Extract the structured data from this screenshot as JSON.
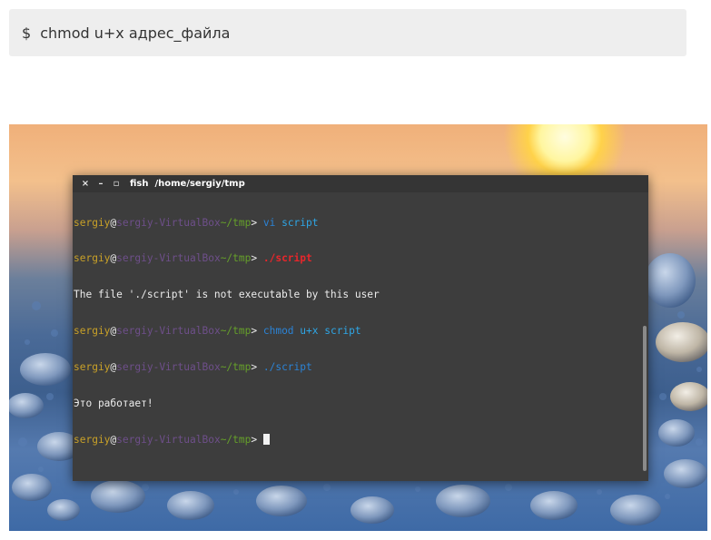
{
  "command_box": {
    "dollar": "$",
    "command": "chmod u+x адрес_файла"
  },
  "terminal": {
    "title_buttons": {
      "close": "×",
      "minimize": "–",
      "maximize": "▫"
    },
    "app_name": "fish",
    "path": "/home/sergiy/tmp",
    "prompt": {
      "user": "sergiy",
      "at": "@",
      "host": "sergiy-VirtualBox",
      "path": "~/tmp",
      "gt": "> "
    },
    "lines": [
      {
        "type": "prompt",
        "cmd": "vi",
        "arg": " script"
      },
      {
        "type": "prompt",
        "cmd": "./script",
        "arg": ""
      },
      {
        "type": "output",
        "text": "The file './script' is not executable by this user"
      },
      {
        "type": "prompt",
        "cmd": "chmod",
        "arg": " u+x script"
      },
      {
        "type": "prompt",
        "cmd": "./script",
        "arg": ""
      },
      {
        "type": "output",
        "text": "Это работает!"
      },
      {
        "type": "prompt",
        "cmd": "",
        "arg": ""
      }
    ]
  },
  "colors": {
    "user": "#c9a128",
    "host": "#6e4f8a",
    "path": "#66a02a",
    "cmd_ok": "#2ea6e6",
    "cmd_error": "#e8262b",
    "cmd_arg": "#2b83d6",
    "terminal_bg": "#3d3d3d"
  }
}
